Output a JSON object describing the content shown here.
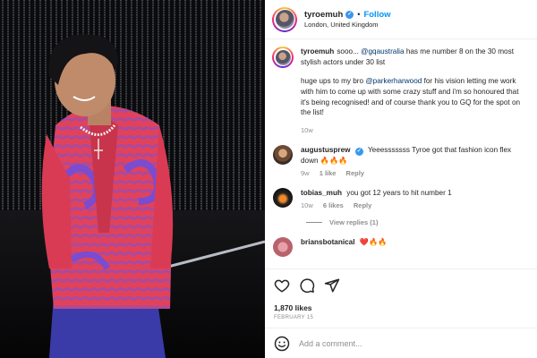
{
  "post": {
    "author": "tyroemuh",
    "follow_label": "Follow",
    "separator": "•",
    "location": "London, United Kingdom"
  },
  "caption": {
    "username": "tyroemuh",
    "part1": "sooo... ",
    "mention1": "@gqaustralia",
    "part2": " has me number 8 on the 30 most stylish actors under 30 list",
    "part3": "huge ups to my bro ",
    "mention2": "@parkerharwood",
    "part4": " for his vision letting me work with him to come up with some crazy stuff and i'm so honoured that it's being recognised! and of course thank you to GQ for the spot on the list!",
    "time": "10w"
  },
  "comments": [
    {
      "username": "augustusprew",
      "text": "Yeeesssssss Tyroe got that fashion icon flex down 🔥🔥🔥",
      "time": "9w",
      "likes": "1 like",
      "reply": "Reply"
    },
    {
      "username": "tobias_muh",
      "text": "you got 12 years to hit number 1",
      "time": "10w",
      "likes": "6 likes",
      "reply": "Reply"
    },
    {
      "username": "briansbotanical",
      "text": "❤️🔥🔥"
    }
  ],
  "view_replies": "View replies (1)",
  "likes_count": "1,870 likes",
  "post_date": "FEBRUARY 15",
  "add_comment": {
    "placeholder": "Add a comment..."
  },
  "icons": {
    "verified": "verified-badge-icon",
    "like": "heart-icon",
    "comment": "comment-bubble-icon",
    "share": "paper-plane-icon",
    "emoji": "smiley-icon"
  },
  "colors": {
    "follow": "#0095f6",
    "verified": "#3897f0",
    "mention": "#00376b",
    "muted": "#8e8e8e"
  }
}
